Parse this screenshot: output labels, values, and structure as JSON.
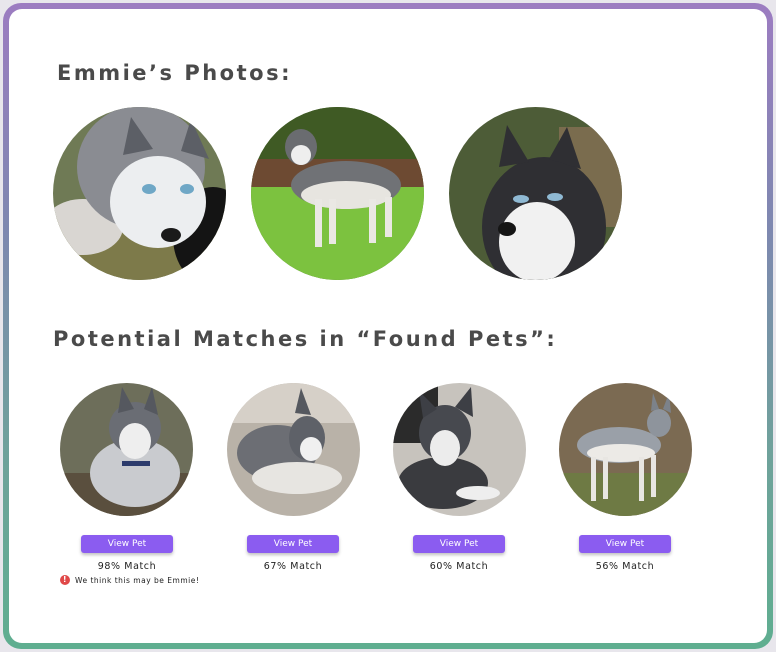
{
  "profile": {
    "photos_title": "Emmie’s Photos:"
  },
  "matches": {
    "section_title": "Potential Matches in “Found Pets”:",
    "items": [
      {
        "button_label": "View Pet",
        "match_text": "98% Match"
      },
      {
        "button_label": "View Pet",
        "match_text": "67% Match"
      },
      {
        "button_label": "View Pet",
        "match_text": "60% Match"
      },
      {
        "button_label": "View Pet",
        "match_text": "56% Match"
      }
    ],
    "top_match_note": "We think this may be Emmie!"
  },
  "icons": {
    "note_icon": "alert-circle-icon"
  },
  "colors": {
    "accent": "#8b5cf0",
    "alert": "#e04848",
    "heading": "#4a4a4a"
  }
}
